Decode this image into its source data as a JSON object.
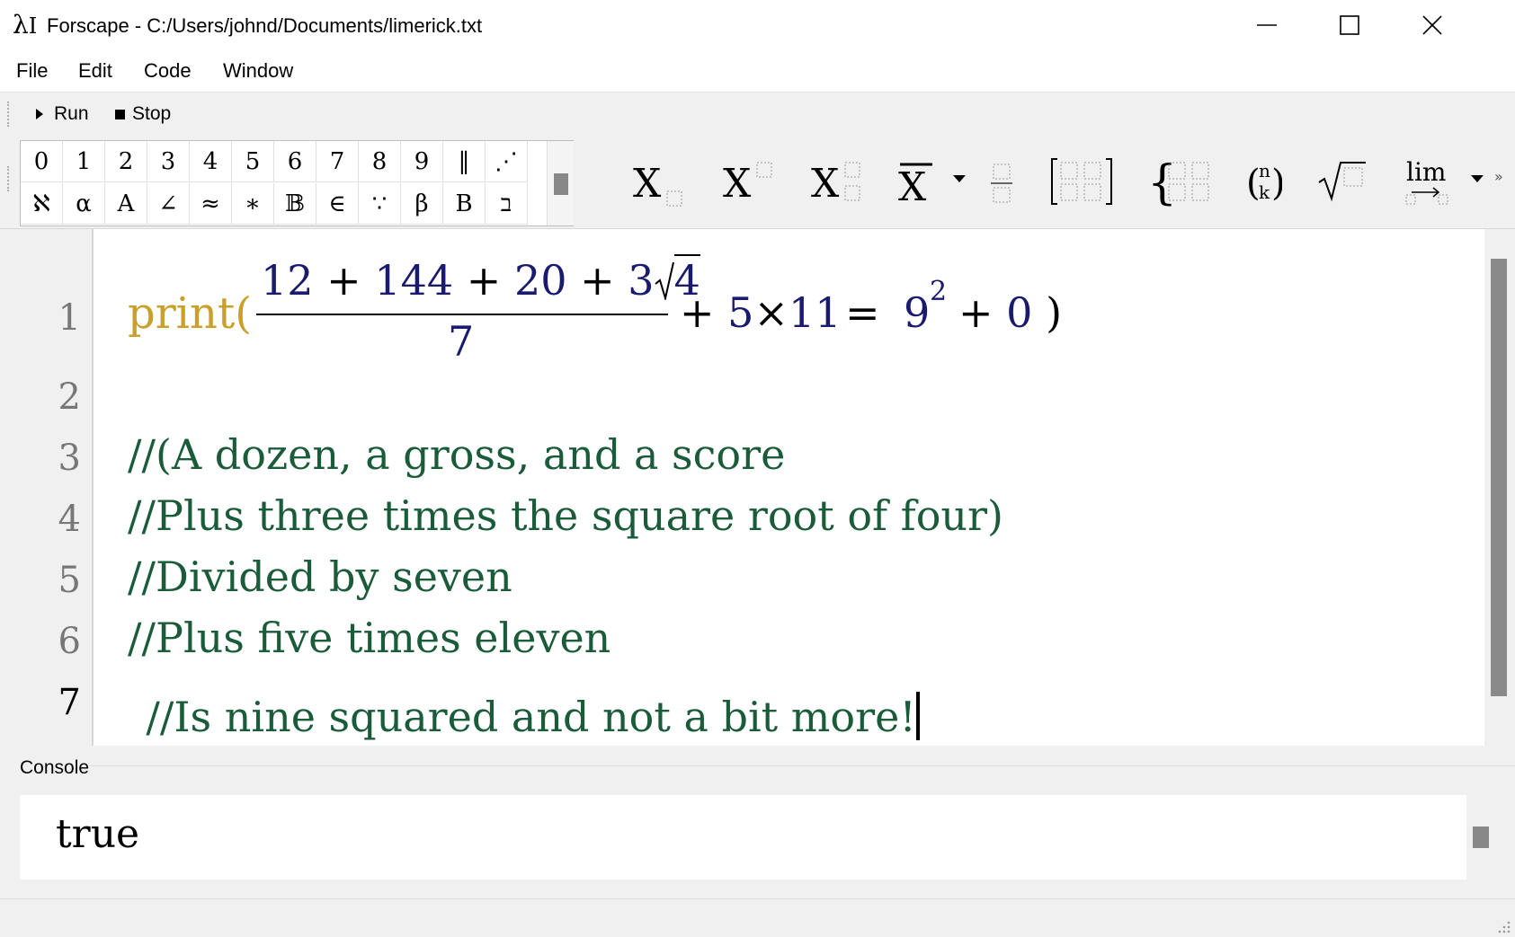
{
  "window": {
    "icon": "λ",
    "icon_suffix": "I",
    "title": "Forscape - C:/Users/johnd/Documents/limerick.txt"
  },
  "menu": [
    "File",
    "Edit",
    "Code",
    "Window"
  ],
  "runbar": {
    "run_label": "Run",
    "stop_label": "Stop"
  },
  "keypad": {
    "row1": [
      "0",
      "1",
      "2",
      "3",
      "4",
      "5",
      "6",
      "7",
      "8",
      "9",
      "‖",
      "⋰"
    ],
    "row2": [
      "ℵ",
      "α",
      "A",
      "∠",
      "≈",
      "∗",
      "𝔹",
      "∈",
      "∵",
      "β",
      "B",
      "ב"
    ]
  },
  "toolbar": {
    "subscript_icon": "subscript-icon",
    "superscript_icon": "superscript-icon",
    "limit_symbol": "lim",
    "binomial_top": "n",
    "binomial_bottom": "k",
    "accent_x": "X"
  },
  "editor": {
    "line_numbers": [
      "1",
      "2",
      "3",
      "4",
      "5",
      "6",
      "7"
    ],
    "line1": {
      "fn": "print(",
      "num_a": "12",
      "plus": "+",
      "num_b": "144",
      "num_c": "20",
      "num_d": "3",
      "sqrt_arg": "4",
      "denominator": "7",
      "tail_a": "5",
      "times": "×",
      "tail_b": "11",
      "eq": "=",
      "base": "9",
      "exp": "2",
      "zero": "0",
      "close": ")"
    },
    "comments": [
      "//(A dozen, a gross, and a score",
      "//Plus three times the square root of four)",
      "//Divided by seven",
      "//Plus five times eleven",
      "//Is nine squared and not a bit more!"
    ]
  },
  "console": {
    "label": "Console",
    "output": "true"
  },
  "colors": {
    "function": "#c8a02a",
    "number": "#1a1a6e",
    "comment": "#1a5c3a"
  }
}
